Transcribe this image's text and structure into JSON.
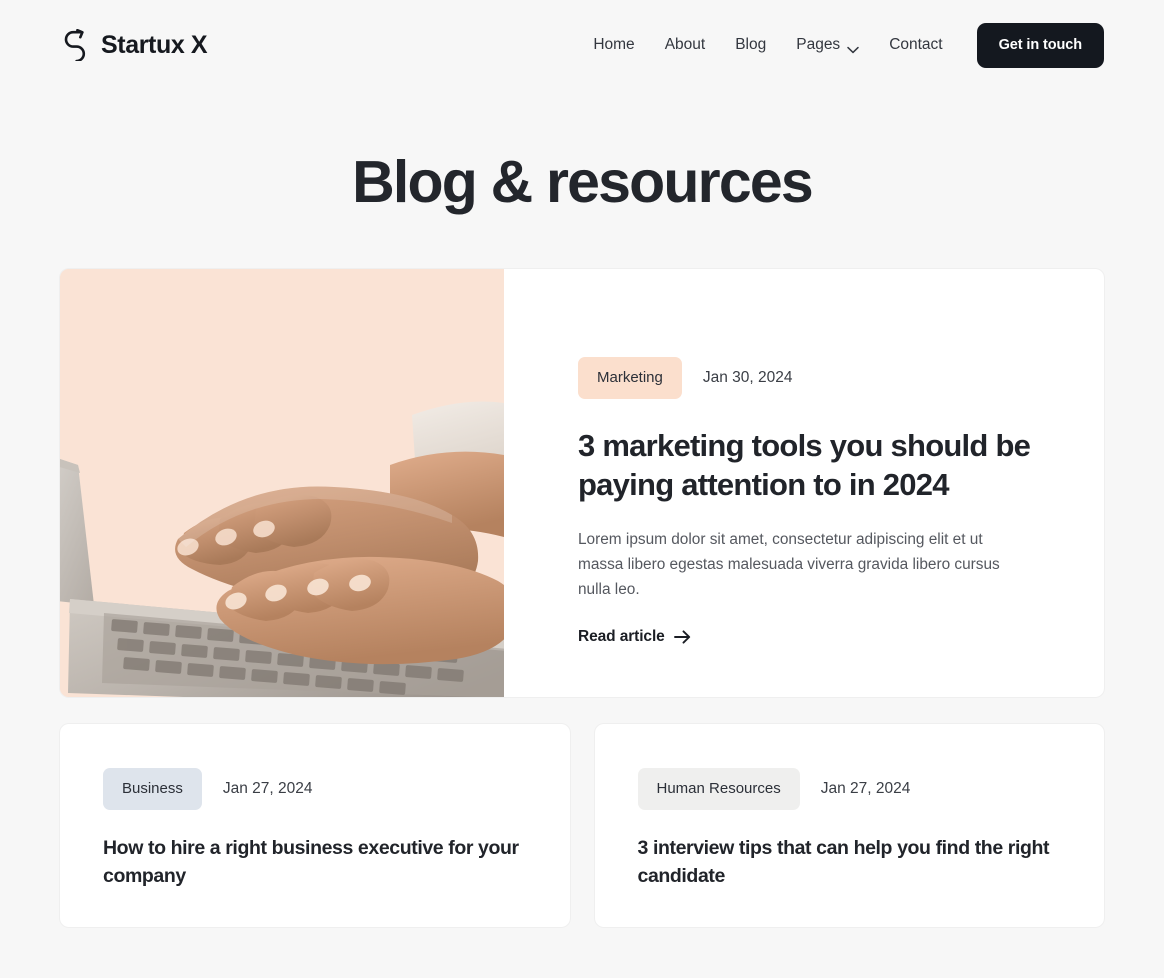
{
  "header": {
    "brand": {
      "name": "Startux X",
      "logo_icon": "zigzag-arrow-logo-icon"
    },
    "nav": [
      {
        "label": "Home",
        "has_chevron": false
      },
      {
        "label": "About",
        "has_chevron": false
      },
      {
        "label": "Blog",
        "has_chevron": false
      },
      {
        "label": "Pages",
        "has_chevron": true
      },
      {
        "label": "Contact",
        "has_chevron": false
      }
    ],
    "cta": {
      "label": "Get in touch",
      "bg_color": "#14181f",
      "text_color": "#ffffff"
    }
  },
  "hero": {
    "title": "Blog & resources"
  },
  "featured_post": {
    "category": "Marketing",
    "category_bg": "#fbdfcd",
    "date": "Jan 30, 2024",
    "title": "3 marketing tools you should be paying attention to in 2024",
    "excerpt": "Lorem ipsum dolor sit amet, consectetur adipiscing elit et ut massa libero egestas malesuada viverra gravida libero cursus nulla leo.",
    "link_label": "Read article",
    "link_icon": "arrow-right-icon",
    "image_alt": "Hands typing on a laptop keyboard on a peach background",
    "image_bg": "#fae3d5"
  },
  "posts": [
    {
      "category": "Business",
      "category_bg": "#dee4ec",
      "date": "Jan 27, 2024",
      "title": "How to hire a right business executive for your company"
    },
    {
      "category": "Human Resources",
      "category_bg": "#efefee",
      "date": "Jan 27, 2024",
      "title": "3 interview tips that can help you find the right candidate"
    }
  ],
  "theme": {
    "page_bg": "#f7f7f7",
    "card_bg": "#ffffff",
    "text_dark": "#21242a",
    "text_muted": "#55585f"
  }
}
